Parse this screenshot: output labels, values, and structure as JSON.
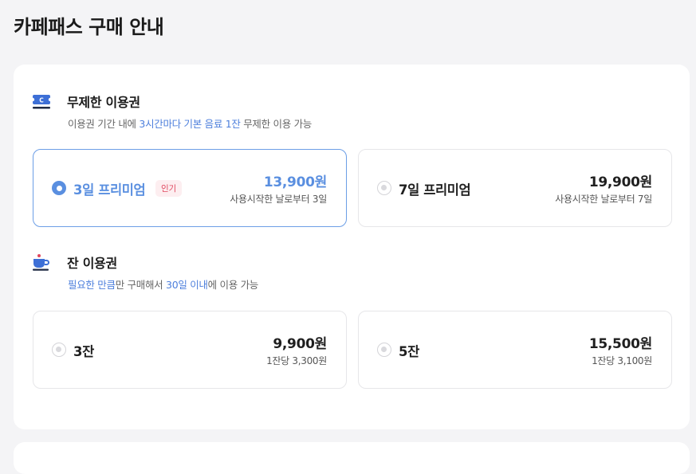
{
  "page": {
    "title": "카페패스 구매 안내"
  },
  "unlimited": {
    "title": "무제한 이용권",
    "desc_prefix": "이용권 기간 내에 ",
    "desc_highlight": "3시간마다 기본 음료 1잔",
    "desc_suffix": " 무제한 이용 가능",
    "options": [
      {
        "name": "3일 프리미엄",
        "badge": "인기",
        "price": "13,900원",
        "sub": "사용시작한 날로부터 3일",
        "selected": true
      },
      {
        "name": "7일 프리미엄",
        "price": "19,900원",
        "sub": "사용시작한 날로부터 7일",
        "selected": false
      }
    ]
  },
  "cup": {
    "title": "잔 이용권",
    "desc_hl1": "필요한 만큼",
    "desc_mid": "만 구매해서 ",
    "desc_hl2": "30일 이내",
    "desc_suffix": "에 이용 가능",
    "options": [
      {
        "name": "3잔",
        "price": "9,900원",
        "sub": "1잔당 3,300원",
        "selected": false
      },
      {
        "name": "5잔",
        "price": "15,500원",
        "sub": "1잔당 3,100원",
        "selected": false
      }
    ]
  },
  "icons": {
    "ticket": "ticket-icon",
    "cup": "coffee-cup-icon"
  },
  "colors": {
    "accent": "#5a8fe0",
    "badge_text": "#e0475e",
    "badge_bg": "#fdeef0"
  }
}
